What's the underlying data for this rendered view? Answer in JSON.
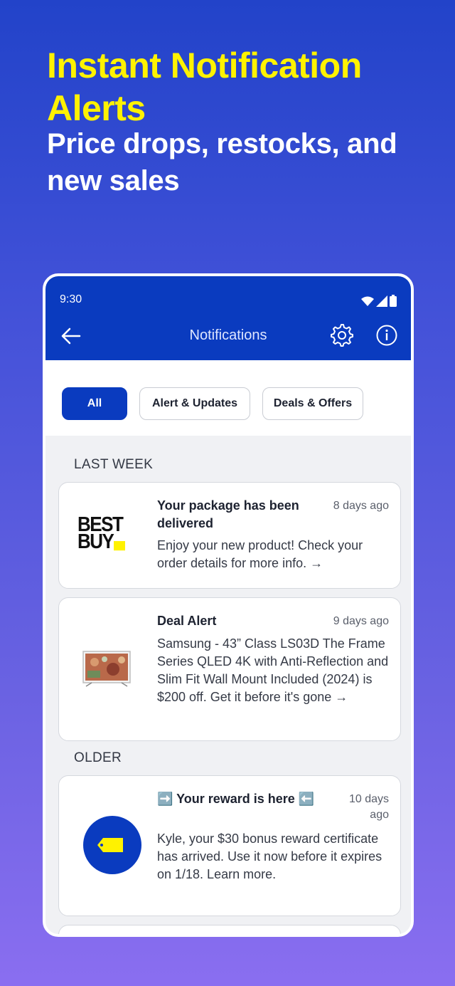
{
  "promo": {
    "headline": "Instant Notification Alerts",
    "subhead": "Price drops, restocks, and new sales"
  },
  "status": {
    "time": "9:30"
  },
  "header": {
    "title": "Notifications"
  },
  "filters": [
    "All",
    "Alert & Updates",
    "Deals & Offers"
  ],
  "sections": {
    "last_week": "LAST WEEK",
    "older": "OLDER"
  },
  "notifications": [
    {
      "title": "Your package has been delivered",
      "time": "8 days ago",
      "body": "Enjoy your new product! Check your order details for more info. →",
      "logo_text_1": "BEST",
      "logo_text_2": "BUY"
    },
    {
      "title": "Deal Alert",
      "time": "9 days ago",
      "body": "Samsung - 43” Class LS03D The Frame Series QLED 4K with Anti-Reflection and Slim Fit Wall Mount Included (2024) is $200 off. Get it before it's gone →"
    },
    {
      "title": "➡️ Your reward is here ⬅️",
      "time": "10 days ago",
      "body": "Kyle, your $30 bonus reward certificate has arrived. Use it now before it expires on 1/18. Learn more."
    }
  ],
  "colors": {
    "brand_blue": "#0a3bbf",
    "brand_yellow": "#fff200"
  }
}
